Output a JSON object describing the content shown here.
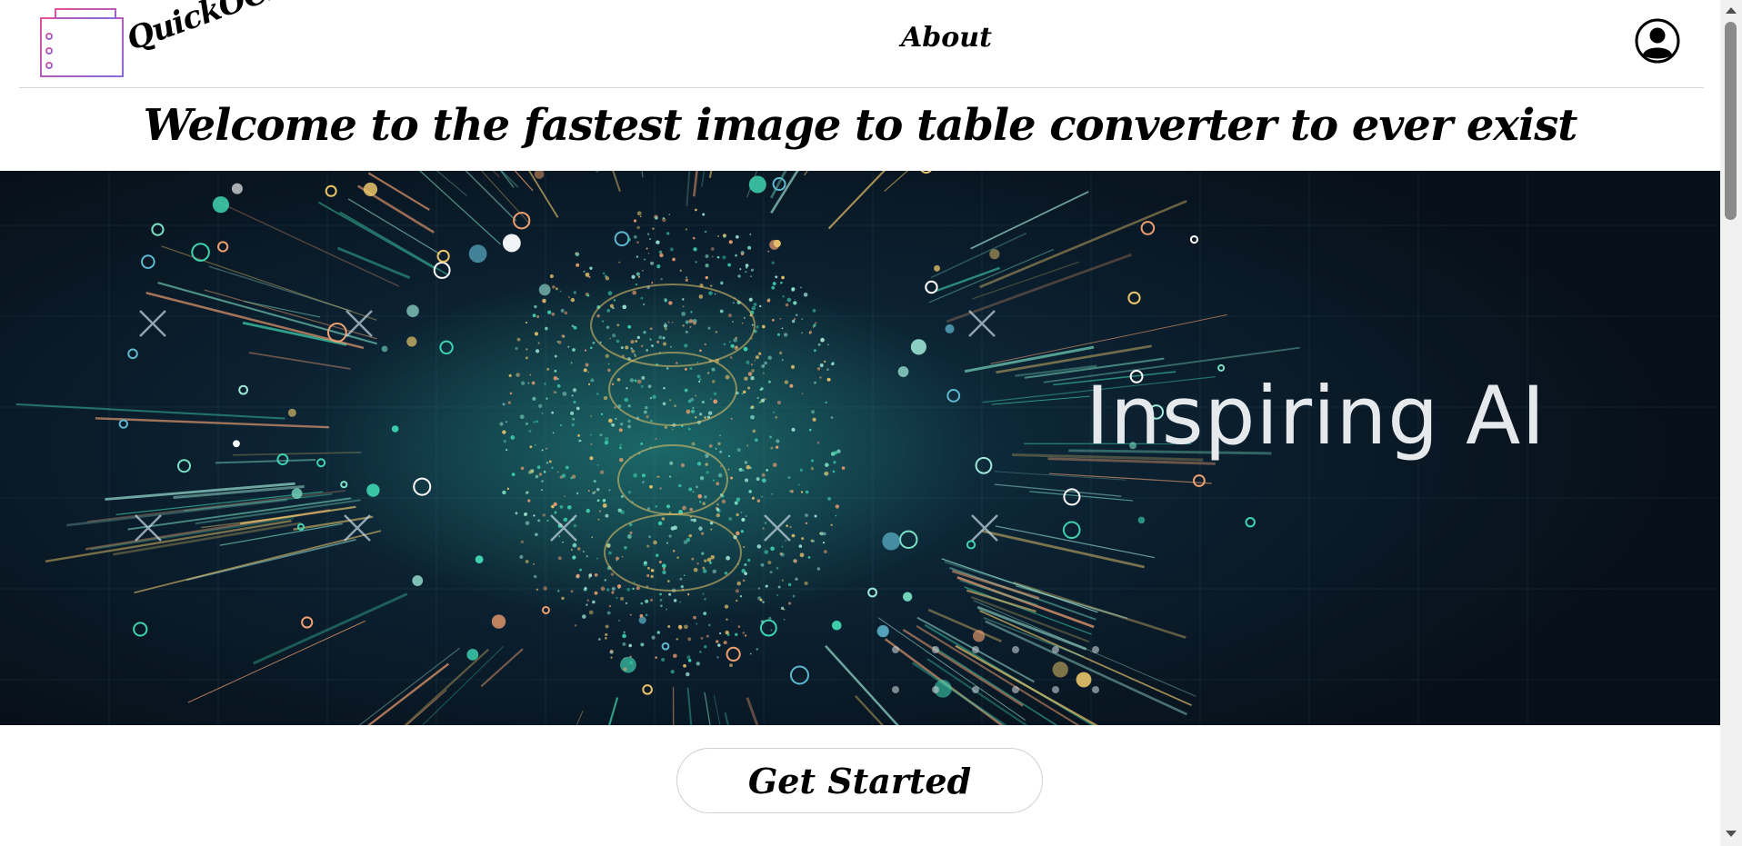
{
  "navbar": {
    "brand": "QuickOCR",
    "about_label": "About",
    "logo_icon": "table-list-icon",
    "avatar_icon": "user-avatar-icon"
  },
  "main": {
    "headline": "Welcome to the fastest image to table converter to ever exist",
    "hero_text": "Inspiring AI",
    "cta_label": "Get Started"
  },
  "colors": {
    "logo_gradient_start": "#e0529c",
    "logo_gradient_end": "#8a6ad8",
    "hero_accent": "#3fd3b0"
  }
}
